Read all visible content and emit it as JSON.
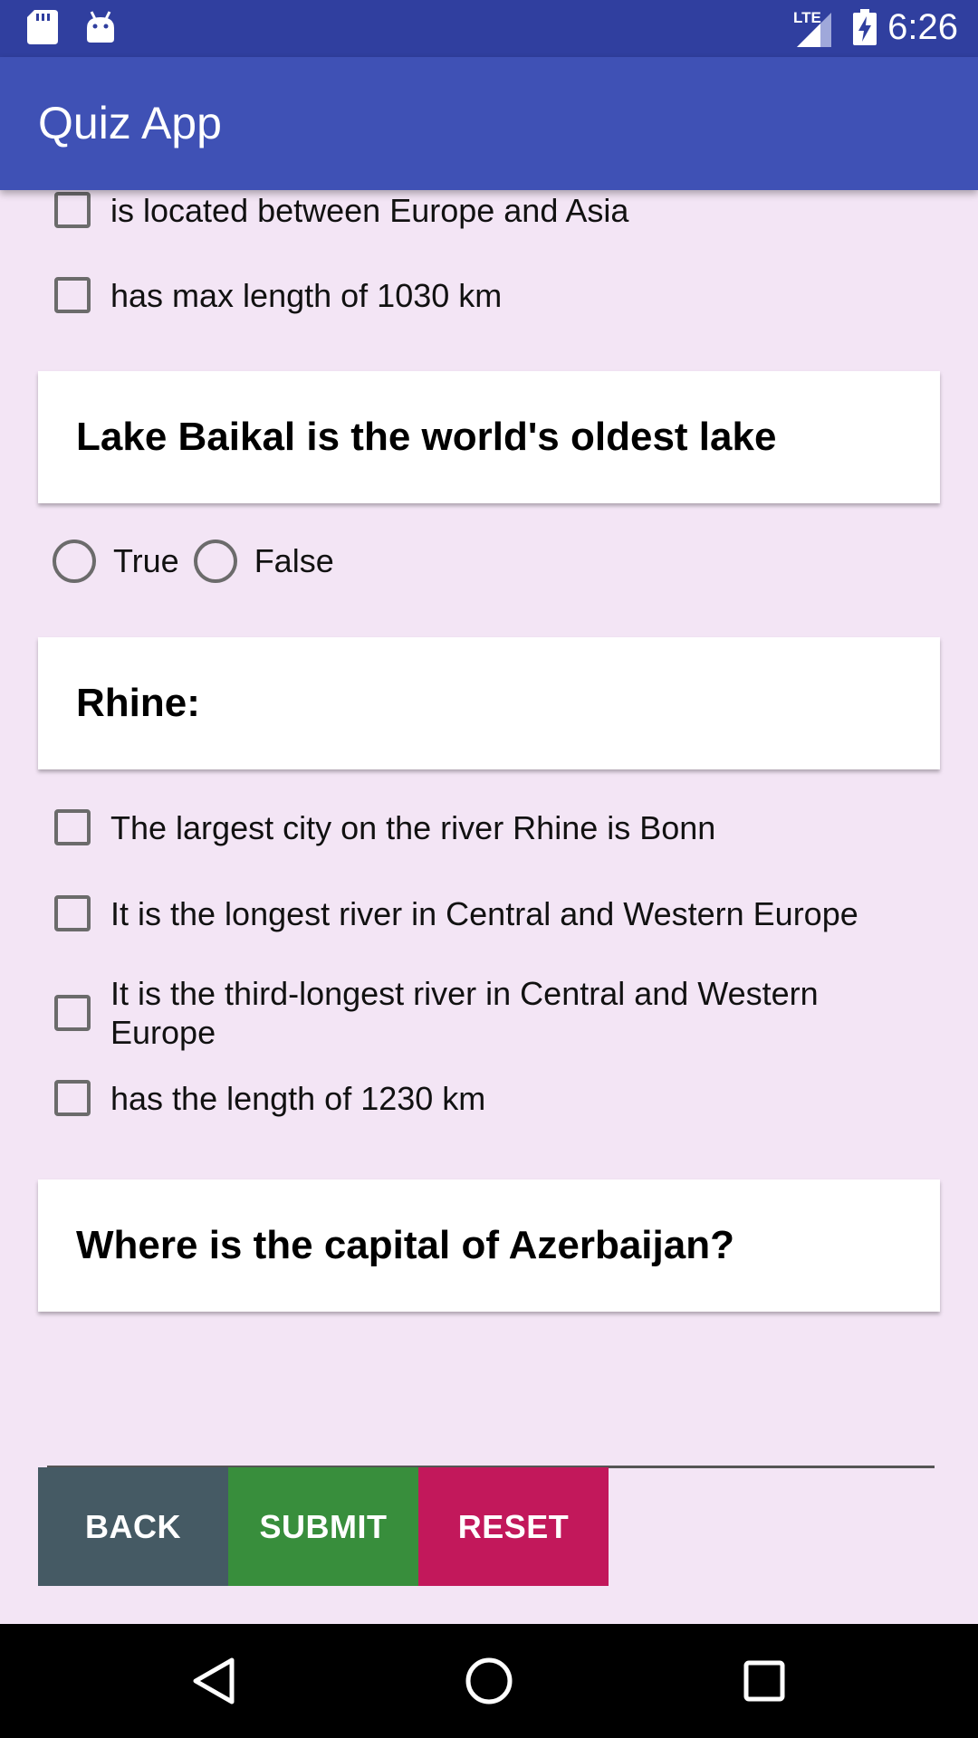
{
  "status_bar": {
    "time": "6:26",
    "network": "LTE",
    "left_icons": [
      "sd-card-icon",
      "android-icon"
    ],
    "right_icons": [
      "signal-icon",
      "battery-charging-icon"
    ]
  },
  "app_bar": {
    "title": "Quiz App"
  },
  "question_partial": {
    "options": [
      "is located between Europe and Asia",
      "has max length of 1030 km"
    ]
  },
  "question_baikal": {
    "title": "Lake Baikal is the world's oldest lake",
    "options": [
      "True",
      "False"
    ]
  },
  "question_rhine": {
    "title": "Rhine:",
    "options": [
      "The largest city on the river Rhine is Bonn",
      "It is the longest river in Central and Western Europe",
      "It is the third-longest river in Central and Western Europe",
      "has the length of 1230 km"
    ]
  },
  "question_azerbaijan": {
    "title": "Where is the capital of Azerbaijan?",
    "answer_value": "",
    "answer_placeholder": ""
  },
  "buttons": {
    "back": "BACK",
    "submit": "SUBMIT",
    "reset": "RESET"
  },
  "colors": {
    "status_bar": "#303f9f",
    "app_bar": "#3f51b5",
    "background": "#f3e5f5",
    "back_button": "#455a64",
    "submit_button": "#388e3c",
    "reset_button": "#c2185b"
  },
  "nav_bar": {
    "icons": [
      "back-triangle-icon",
      "home-circle-icon",
      "recents-square-icon"
    ]
  }
}
